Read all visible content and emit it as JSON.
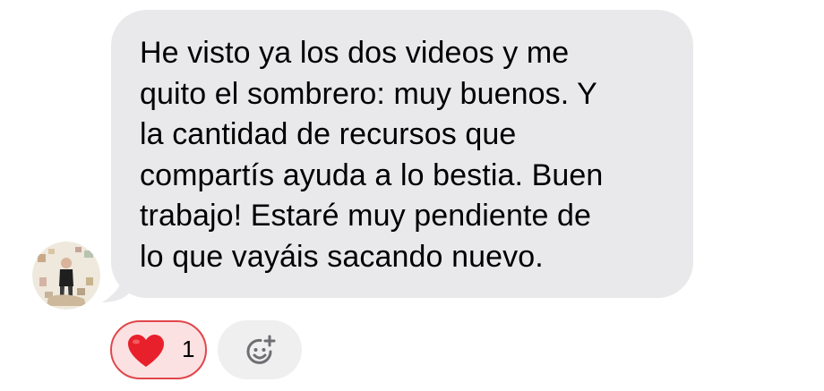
{
  "message": {
    "lines": [
      "He visto ya los dos videos y me",
      "quito el sombrero: muy buenos. Y",
      "la cantidad de recursos que",
      "compartís ayuda a lo bestia. Buen",
      "trabajo! Estaré muy pendiente de",
      "lo que vayáis sacando nuevo."
    ]
  },
  "reactions": [
    {
      "icon": "red-heart-icon",
      "count": "1",
      "selected": true
    }
  ],
  "add_reaction": {
    "icon": "add-emoji-icon"
  },
  "colors": {
    "bubble": "#e9e9eb",
    "reaction_border": "#e0464b",
    "reaction_fill": "#fbe1e2",
    "heart": "#e8202b",
    "add_reaction_bg": "#efefef",
    "add_reaction_icon": "#6e6e73"
  }
}
